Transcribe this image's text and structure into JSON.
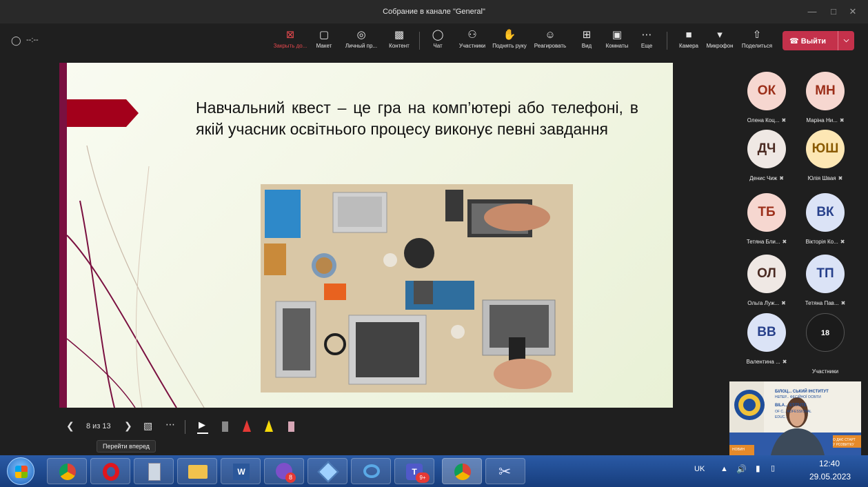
{
  "window": {
    "title": "Собрание в канале \"General\""
  },
  "meeting": {
    "timer": "--:--"
  },
  "toolbar": {
    "buttons": [
      {
        "label": "Закрыть до...",
        "icon": "close-box-icon"
      },
      {
        "label": "Макет",
        "icon": "layout-icon"
      },
      {
        "label": "Личный пр...",
        "icon": "eye-icon"
      },
      {
        "label": "Контент",
        "icon": "share-content-icon"
      },
      {
        "label": "Чат",
        "icon": "chat-icon"
      },
      {
        "label": "Участники",
        "icon": "people-icon"
      },
      {
        "label": "Поднять руку",
        "icon": "hand-icon"
      },
      {
        "label": "Реагировать",
        "icon": "emoji-icon"
      },
      {
        "label": "Вид",
        "icon": "view-icon"
      },
      {
        "label": "Комнаты",
        "icon": "rooms-icon"
      },
      {
        "label": "Еще",
        "icon": "more-icon"
      },
      {
        "label": "Камера",
        "icon": "camera-icon"
      },
      {
        "label": "Микрофон",
        "icon": "mic-icon"
      },
      {
        "label": "Поделиться",
        "icon": "share-icon"
      }
    ],
    "leave_label": "Выйти"
  },
  "slide": {
    "text": "Навчальний квест – це гра на комп’ютері або телефоні, в якій учасник освітнього процесу виконує певні завдання",
    "accent_color": "#a3001b",
    "bar_color": "#7a1040"
  },
  "slide_controls": {
    "page": "8 из 13",
    "tooltip": "Перейти вперед"
  },
  "participants": [
    {
      "initials": "ОК",
      "name": "Олена Коц...",
      "bg": "#f6d7d0",
      "fg": "#9c2f1a"
    },
    {
      "initials": "МН",
      "name": "Маріна Ни...",
      "bg": "#f6d7d0",
      "fg": "#9c2f1a"
    },
    {
      "initials": "ДЧ",
      "name": "Денис Чиж",
      "bg": "#efe8e4",
      "fg": "#4a2a22"
    },
    {
      "initials": "ЮШ",
      "name": "Юлія Швая",
      "bg": "#fde7b4",
      "fg": "#8a5a00"
    },
    {
      "initials": "ТБ",
      "name": "Тетяна Бли...",
      "bg": "#f6d7d0",
      "fg": "#9c2f1a"
    },
    {
      "initials": "ВК",
      "name": "Вікторія Ко...",
      "bg": "#dbe3f6",
      "fg": "#27408b"
    },
    {
      "initials": "ОЛ",
      "name": "Ольга Луж...",
      "bg": "#efe8e4",
      "fg": "#4a2a22"
    },
    {
      "initials": "ТП",
      "name": "Тетяна Пав...",
      "bg": "#dbe3f6",
      "fg": "#27408b"
    },
    {
      "initials": "ВВ",
      "name": "Валентина ...",
      "bg": "#dbe3f6",
      "fg": "#27408b"
    }
  ],
  "participants_more": {
    "count": "18",
    "label": "Участники"
  },
  "video": {
    "line1": "БІЛОЦ... СЬКИЙ ІНСТИТУТ",
    "line2": "НЕПЕР... ФЕСІЙНОЇ ОСВІТИ",
    "line3": "BILA... STITUTE",
    "line4": "OF C... ROFESSIONAL",
    "line5": "EDUC...",
    "line6": "О ДАЄ СТАРТ",
    "line7": "У РОЗВИТКУ",
    "line8": "НОВИН"
  },
  "taskbar": {
    "badges": {
      "viber": "8",
      "teams": "9+"
    },
    "lang": "UK",
    "time": "12:40",
    "date": "29.05.2023"
  }
}
